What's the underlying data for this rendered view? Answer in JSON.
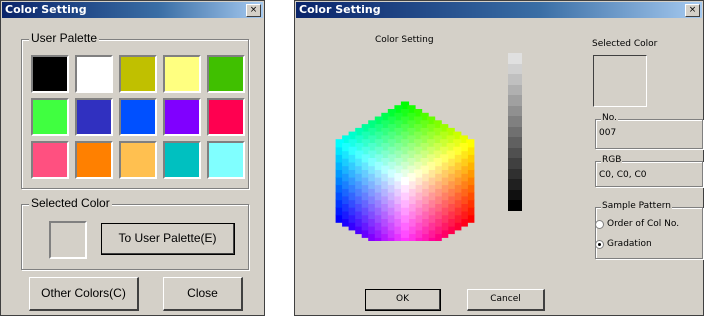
{
  "left_dialog": {
    "title": "Color Setting",
    "close_glyph": "×",
    "user_palette_label": "User Palette",
    "palette_colors": [
      "#000000",
      "#ffffff",
      "#c0c000",
      "#ffff80",
      "#40c000",
      "#40ff40",
      "#3030c0",
      "#0050ff",
      "#8000ff",
      "#ff0050",
      "#ff5080",
      "#ff8000",
      "#ffc050",
      "#00c0c0",
      "#80ffff"
    ],
    "selected_color_label": "Selected Color",
    "to_user_palette_button": "To User Palette(E)",
    "other_colors_button": "Other Colors(C)",
    "close_button": "Close"
  },
  "right_dialog": {
    "title": "Color Setting",
    "close_glyph": "×",
    "hex_caption": "Color Setting",
    "selected_color_label": "Selected Color",
    "no_label": "No.",
    "no_value": "007",
    "rgb_label": "RGB",
    "rgb_value": "C0, C0, C0",
    "sample_pattern_label": "Sample Pattern",
    "option_order": "Order of Col No.",
    "option_gradation": "Gradation",
    "selected_option": "Gradation",
    "ok_button": "OK",
    "cancel_button": "Cancel",
    "gray_ramp": [
      "#e0e0e0",
      "#d0d0d0",
      "#c0c0c0",
      "#b0b0b0",
      "#a0a0a0",
      "#909090",
      "#808080",
      "#707070",
      "#606060",
      "#505050",
      "#404040",
      "#303030",
      "#202020",
      "#101010",
      "#000000"
    ]
  }
}
